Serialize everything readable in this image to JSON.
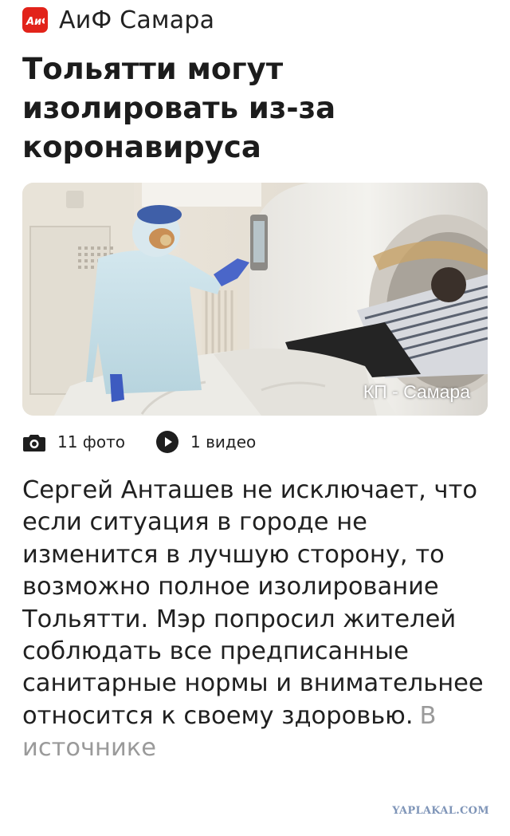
{
  "source": {
    "logo_text": "АиФ",
    "logo_icon": "aif-logo-icon",
    "name": "АиФ Самара"
  },
  "headline": "Тольятти могут изолировать из-за коронавируса",
  "photo": {
    "credit": "КП - Самара"
  },
  "media": {
    "photos_icon": "camera-icon",
    "photos_label": "11 фото",
    "video_icon": "play-icon",
    "video_label": "1 видео"
  },
  "summary": {
    "text": "Сергей Анташев не исключает, что если ситуация в городе не изменится в лучшую сторону, то возможно полное изолирование Тольятти. Мэр попросил жителей соблюдать все предписанные санитарные нормы и внимательнее относится к своему здоровью.",
    "source_link": "В источнике"
  },
  "watermark": "YAPLAKAL.COM",
  "colors": {
    "logo_red": "#e2231a",
    "link_gray": "#9a9a9a",
    "watermark_blue": "#7f95b8"
  }
}
